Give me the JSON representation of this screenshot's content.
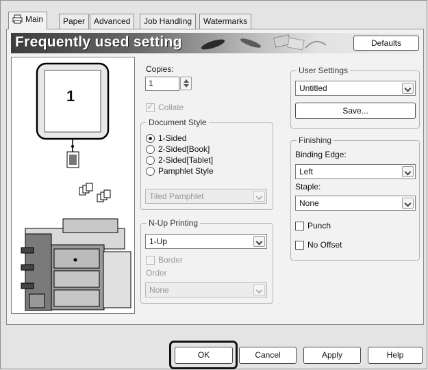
{
  "tabs": [
    {
      "label": "Main",
      "active": true,
      "icon": "printer-icon"
    },
    {
      "label": "Paper"
    },
    {
      "label": "Advanced"
    },
    {
      "label": "Job Handling"
    },
    {
      "label": "Watermarks"
    }
  ],
  "banner": {
    "title": "Frequently used setting",
    "defaults_label": "Defaults"
  },
  "preview": {
    "page_number": "1"
  },
  "copies": {
    "label": "Copies:",
    "value": "1"
  },
  "collate": {
    "label": "Collate",
    "checked": true,
    "enabled": false
  },
  "document_style": {
    "label": "Document Style",
    "options": [
      "1-Sided",
      "2-Sided[Book]",
      "2-Sided[Tablet]",
      "Pamphlet Style"
    ],
    "selected": "1-Sided",
    "pamphlet_select": "Tiled Pamphlet"
  },
  "nup": {
    "label": "N-Up Printing",
    "value": "1-Up",
    "border_label": "Border",
    "order_label": "Order",
    "order_value": "None"
  },
  "user_settings": {
    "label": "User Settings",
    "value": "Untitled",
    "save_label": "Save..."
  },
  "finishing": {
    "label": "Finishing",
    "binding_edge_label": "Binding Edge:",
    "binding_edge_value": "Left",
    "staple_label": "Staple:",
    "staple_value": "None",
    "punch_label": "Punch",
    "no_offset_label": "No Offset"
  },
  "buttons": {
    "ok": "OK",
    "cancel": "Cancel",
    "apply": "Apply",
    "help": "Help"
  }
}
